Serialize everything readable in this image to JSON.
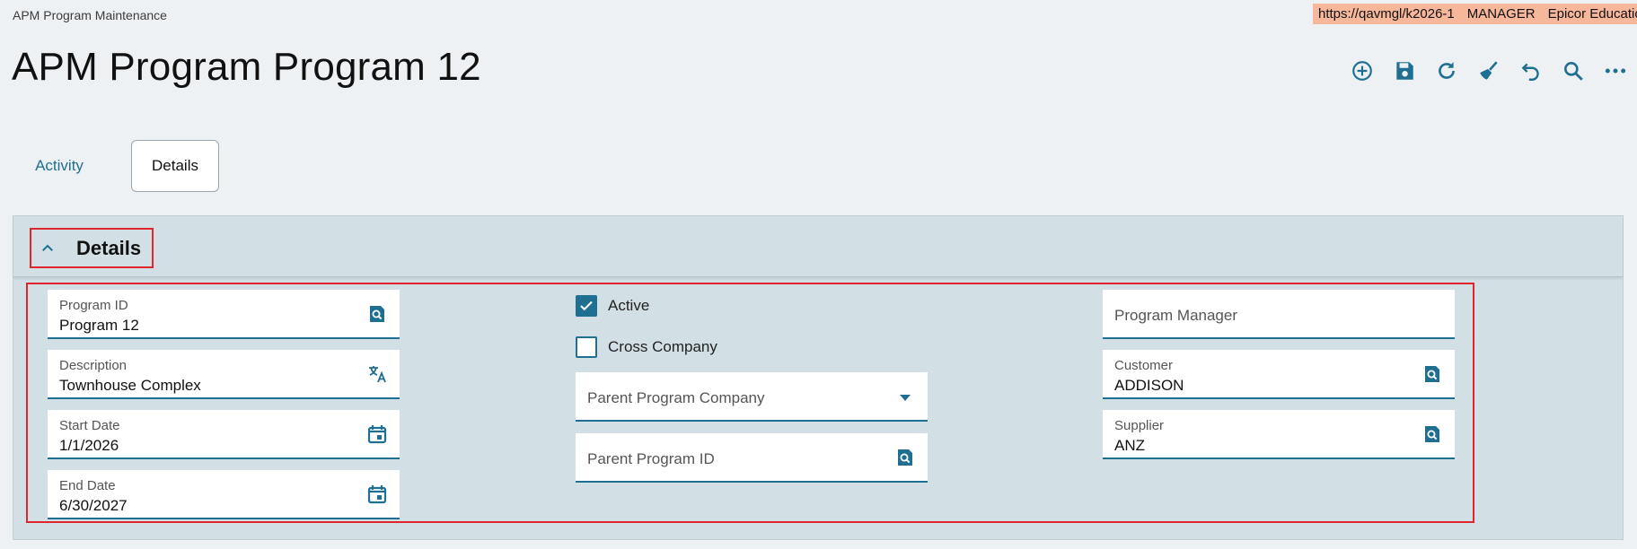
{
  "app": {
    "title": "APM Program Maintenance",
    "page_title": "APM Program Program 12"
  },
  "env": {
    "url": "https://qavmgl/k2026-1",
    "user": "MANAGER",
    "company": "Epicor Education"
  },
  "toolbar": {
    "buttons": [
      {
        "name": "add-new-icon"
      },
      {
        "name": "save-icon"
      },
      {
        "name": "refresh-icon"
      },
      {
        "name": "clear-broom-icon"
      },
      {
        "name": "undo-icon"
      },
      {
        "name": "search-icon"
      },
      {
        "name": "more-options-icon"
      }
    ]
  },
  "tabs": [
    {
      "label": "Activity"
    },
    {
      "label": "Details",
      "selected": true
    }
  ],
  "panel": {
    "header": "Details",
    "collapsed": false
  },
  "fields": {
    "program_id": {
      "label": "Program ID",
      "value": "Program 12"
    },
    "description": {
      "label": "Description",
      "value": "Townhouse Complex"
    },
    "start_date": {
      "label": "Start Date",
      "value": "1/1/2026"
    },
    "end_date": {
      "label": "End Date",
      "value": "6/30/2027"
    },
    "active": {
      "label": "Active",
      "checked": true
    },
    "cross_company": {
      "label": "Cross Company",
      "checked": false
    },
    "parent_program_company": {
      "placeholder": "Parent Program Company"
    },
    "parent_program_id": {
      "placeholder": "Parent Program ID"
    },
    "program_manager": {
      "placeholder": "Program Manager"
    },
    "customer": {
      "label": "Customer",
      "value": "ADDISON"
    },
    "supplier": {
      "label": "Supplier",
      "value": "ANZ"
    }
  },
  "colors": {
    "accent": "#1f6f93",
    "highlight": "#e0262d",
    "banner": "#f6b79a",
    "panel_bg": "#d2dfe4"
  }
}
